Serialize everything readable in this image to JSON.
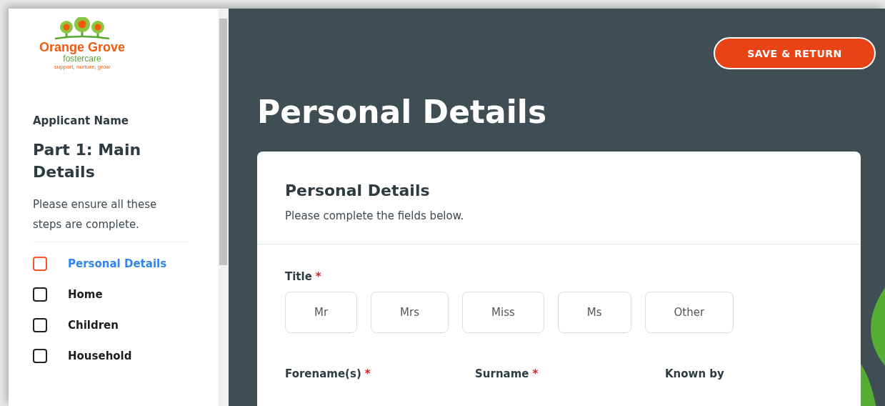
{
  "logo": {
    "name": "Orange Grove",
    "sub": "fostercare",
    "tagline": "support, nurture, grow"
  },
  "sidebar": {
    "applicant": "Applicant Name",
    "part_title": "Part 1: Main Details",
    "intro": "Please ensure all these steps are complete.",
    "steps": [
      {
        "label": "Personal Details",
        "selected": true,
        "checked": false
      },
      {
        "label": "Home",
        "selected": false,
        "checked": false
      },
      {
        "label": "Children",
        "selected": false,
        "checked": false
      },
      {
        "label": "Household",
        "selected": false,
        "checked": false
      }
    ]
  },
  "save_button": "SAVE & RETURN",
  "page_title": "Personal Details",
  "card": {
    "title": "Personal Details",
    "subtitle": "Please complete the fields below.",
    "title_field": {
      "label": "Title",
      "required_mark": "*",
      "options": [
        {
          "label": "Mr",
          "selected": false
        },
        {
          "label": "Mrs",
          "selected": false
        },
        {
          "label": "Miss",
          "selected": false
        },
        {
          "label": "Ms",
          "selected": false
        },
        {
          "label": "Other",
          "selected": false
        }
      ]
    },
    "fields": [
      {
        "label": "Forename(s)",
        "required_mark": "*"
      },
      {
        "label": "Surname",
        "required_mark": "*"
      },
      {
        "label": "Known by"
      }
    ]
  }
}
